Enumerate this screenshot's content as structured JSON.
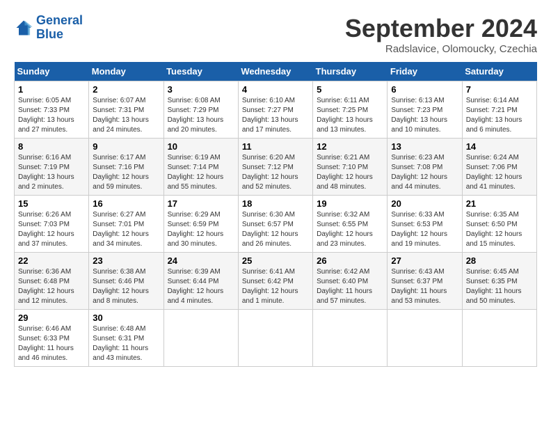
{
  "header": {
    "logo_line1": "General",
    "logo_line2": "Blue",
    "month": "September 2024",
    "location": "Radslavice, Olomoucky, Czechia"
  },
  "columns": [
    "Sunday",
    "Monday",
    "Tuesday",
    "Wednesday",
    "Thursday",
    "Friday",
    "Saturday"
  ],
  "weeks": [
    [
      {
        "day": "1",
        "info": "Sunrise: 6:05 AM\nSunset: 7:33 PM\nDaylight: 13 hours\nand 27 minutes."
      },
      {
        "day": "2",
        "info": "Sunrise: 6:07 AM\nSunset: 7:31 PM\nDaylight: 13 hours\nand 24 minutes."
      },
      {
        "day": "3",
        "info": "Sunrise: 6:08 AM\nSunset: 7:29 PM\nDaylight: 13 hours\nand 20 minutes."
      },
      {
        "day": "4",
        "info": "Sunrise: 6:10 AM\nSunset: 7:27 PM\nDaylight: 13 hours\nand 17 minutes."
      },
      {
        "day": "5",
        "info": "Sunrise: 6:11 AM\nSunset: 7:25 PM\nDaylight: 13 hours\nand 13 minutes."
      },
      {
        "day": "6",
        "info": "Sunrise: 6:13 AM\nSunset: 7:23 PM\nDaylight: 13 hours\nand 10 minutes."
      },
      {
        "day": "7",
        "info": "Sunrise: 6:14 AM\nSunset: 7:21 PM\nDaylight: 13 hours\nand 6 minutes."
      }
    ],
    [
      {
        "day": "8",
        "info": "Sunrise: 6:16 AM\nSunset: 7:19 PM\nDaylight: 13 hours\nand 2 minutes."
      },
      {
        "day": "9",
        "info": "Sunrise: 6:17 AM\nSunset: 7:16 PM\nDaylight: 12 hours\nand 59 minutes."
      },
      {
        "day": "10",
        "info": "Sunrise: 6:19 AM\nSunset: 7:14 PM\nDaylight: 12 hours\nand 55 minutes."
      },
      {
        "day": "11",
        "info": "Sunrise: 6:20 AM\nSunset: 7:12 PM\nDaylight: 12 hours\nand 52 minutes."
      },
      {
        "day": "12",
        "info": "Sunrise: 6:21 AM\nSunset: 7:10 PM\nDaylight: 12 hours\nand 48 minutes."
      },
      {
        "day": "13",
        "info": "Sunrise: 6:23 AM\nSunset: 7:08 PM\nDaylight: 12 hours\nand 44 minutes."
      },
      {
        "day": "14",
        "info": "Sunrise: 6:24 AM\nSunset: 7:06 PM\nDaylight: 12 hours\nand 41 minutes."
      }
    ],
    [
      {
        "day": "15",
        "info": "Sunrise: 6:26 AM\nSunset: 7:03 PM\nDaylight: 12 hours\nand 37 minutes."
      },
      {
        "day": "16",
        "info": "Sunrise: 6:27 AM\nSunset: 7:01 PM\nDaylight: 12 hours\nand 34 minutes."
      },
      {
        "day": "17",
        "info": "Sunrise: 6:29 AM\nSunset: 6:59 PM\nDaylight: 12 hours\nand 30 minutes."
      },
      {
        "day": "18",
        "info": "Sunrise: 6:30 AM\nSunset: 6:57 PM\nDaylight: 12 hours\nand 26 minutes."
      },
      {
        "day": "19",
        "info": "Sunrise: 6:32 AM\nSunset: 6:55 PM\nDaylight: 12 hours\nand 23 minutes."
      },
      {
        "day": "20",
        "info": "Sunrise: 6:33 AM\nSunset: 6:53 PM\nDaylight: 12 hours\nand 19 minutes."
      },
      {
        "day": "21",
        "info": "Sunrise: 6:35 AM\nSunset: 6:50 PM\nDaylight: 12 hours\nand 15 minutes."
      }
    ],
    [
      {
        "day": "22",
        "info": "Sunrise: 6:36 AM\nSunset: 6:48 PM\nDaylight: 12 hours\nand 12 minutes."
      },
      {
        "day": "23",
        "info": "Sunrise: 6:38 AM\nSunset: 6:46 PM\nDaylight: 12 hours\nand 8 minutes."
      },
      {
        "day": "24",
        "info": "Sunrise: 6:39 AM\nSunset: 6:44 PM\nDaylight: 12 hours\nand 4 minutes."
      },
      {
        "day": "25",
        "info": "Sunrise: 6:41 AM\nSunset: 6:42 PM\nDaylight: 12 hours\nand 1 minute."
      },
      {
        "day": "26",
        "info": "Sunrise: 6:42 AM\nSunset: 6:40 PM\nDaylight: 11 hours\nand 57 minutes."
      },
      {
        "day": "27",
        "info": "Sunrise: 6:43 AM\nSunset: 6:37 PM\nDaylight: 11 hours\nand 53 minutes."
      },
      {
        "day": "28",
        "info": "Sunrise: 6:45 AM\nSunset: 6:35 PM\nDaylight: 11 hours\nand 50 minutes."
      }
    ],
    [
      {
        "day": "29",
        "info": "Sunrise: 6:46 AM\nSunset: 6:33 PM\nDaylight: 11 hours\nand 46 minutes."
      },
      {
        "day": "30",
        "info": "Sunrise: 6:48 AM\nSunset: 6:31 PM\nDaylight: 11 hours\nand 43 minutes."
      },
      {
        "day": "",
        "info": ""
      },
      {
        "day": "",
        "info": ""
      },
      {
        "day": "",
        "info": ""
      },
      {
        "day": "",
        "info": ""
      },
      {
        "day": "",
        "info": ""
      }
    ]
  ]
}
